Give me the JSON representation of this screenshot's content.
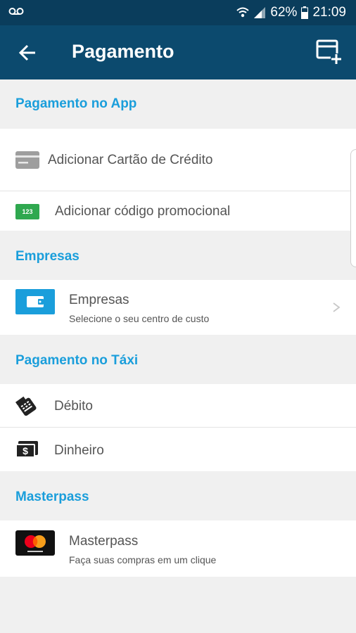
{
  "status_bar": {
    "battery": "62%",
    "time": "21:09"
  },
  "app_bar": {
    "title": "Pagamento"
  },
  "sections": {
    "app": {
      "title": "Pagamento no App"
    },
    "companies": {
      "title": "Empresas"
    },
    "taxi": {
      "title": "Pagamento no Táxi"
    },
    "masterpass": {
      "title": "Masterpass"
    }
  },
  "rows": {
    "credit_card": {
      "label": "Adicionar Cartão de Crédito"
    },
    "promo": {
      "label": "Adicionar código promocional",
      "icon_text": "123"
    },
    "companies": {
      "label": "Empresas",
      "sub": "Selecione o seu centro de custo"
    },
    "debit": {
      "label": "Débito"
    },
    "cash": {
      "label": "Dinheiro",
      "icon_text": "$"
    },
    "masterpass": {
      "label": "Masterpass",
      "sub": "Faça suas compras em um clique"
    }
  },
  "colors": {
    "app_bar": "#0c4a6e",
    "status_bar": "#0a3d5c",
    "accent": "#1a9edb",
    "promo_green": "#2fa84f"
  }
}
